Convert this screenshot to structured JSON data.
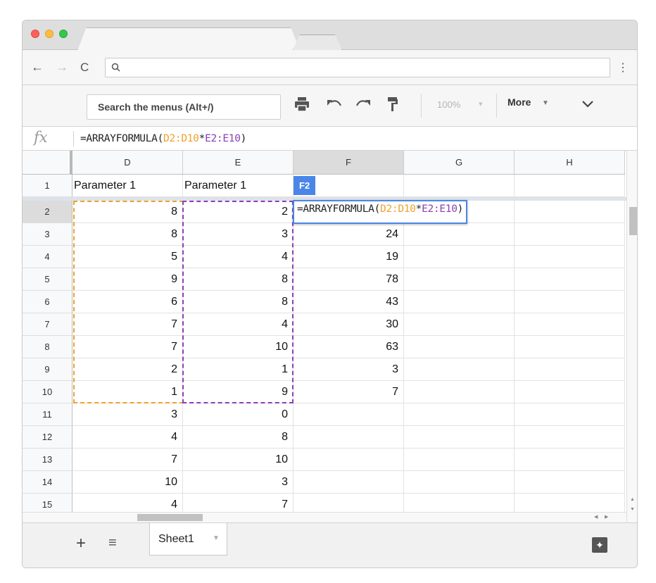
{
  "browser": {
    "nav": {
      "back": "←",
      "forward": "→",
      "reload": "C"
    },
    "omnibox_icon": "magnifier-icon",
    "menu_dots": "⋮"
  },
  "toolbar": {
    "search_menus": "Search the menus (Alt+/)",
    "zoom": "100%",
    "more": "More"
  },
  "formula_bar": {
    "fx": "fx",
    "prefix": "=ARRAYFORMULA(",
    "ref1": "D2:D10",
    "op": "*",
    "ref2": "E2:E10",
    "suffix": ")"
  },
  "grid": {
    "columns": [
      "D",
      "E",
      "F",
      "G",
      "H"
    ],
    "rows": [
      {
        "n": "1",
        "D": "Parameter 1",
        "E": "Parameter 1",
        "F": ""
      },
      {
        "n": "2",
        "D": "8",
        "E": "2",
        "F": ""
      },
      {
        "n": "3",
        "D": "8",
        "E": "3",
        "F": "24"
      },
      {
        "n": "4",
        "D": "5",
        "E": "4",
        "F": "19"
      },
      {
        "n": "5",
        "D": "9",
        "E": "8",
        "F": "78"
      },
      {
        "n": "6",
        "D": "6",
        "E": "8",
        "F": "43"
      },
      {
        "n": "7",
        "D": "7",
        "E": "4",
        "F": "30"
      },
      {
        "n": "8",
        "D": "7",
        "E": "10",
        "F": "63"
      },
      {
        "n": "9",
        "D": "2",
        "E": "1",
        "F": "3"
      },
      {
        "n": "10",
        "D": "1",
        "E": "9",
        "F": "7"
      },
      {
        "n": "11",
        "D": "3",
        "E": "0",
        "F": ""
      },
      {
        "n": "12",
        "D": "4",
        "E": "8",
        "F": ""
      },
      {
        "n": "13",
        "D": "7",
        "E": "10",
        "F": ""
      },
      {
        "n": "14",
        "D": "10",
        "E": "3",
        "F": ""
      },
      {
        "n": "15",
        "D": "4",
        "E": "7",
        "F": ""
      }
    ],
    "ref_tag": "F2",
    "editor": {
      "prefix": "=ARRAYFORMULA(",
      "ref1": "D2:D10",
      "op": "*",
      "ref2": "E2:E10",
      "suffix": ")"
    },
    "colors": {
      "ref1": "#f0a12b",
      "ref2": "#8b3fb5",
      "active": "#4a86e8"
    }
  },
  "sheets": {
    "tabs": [
      {
        "label": "Sheet1"
      }
    ]
  }
}
